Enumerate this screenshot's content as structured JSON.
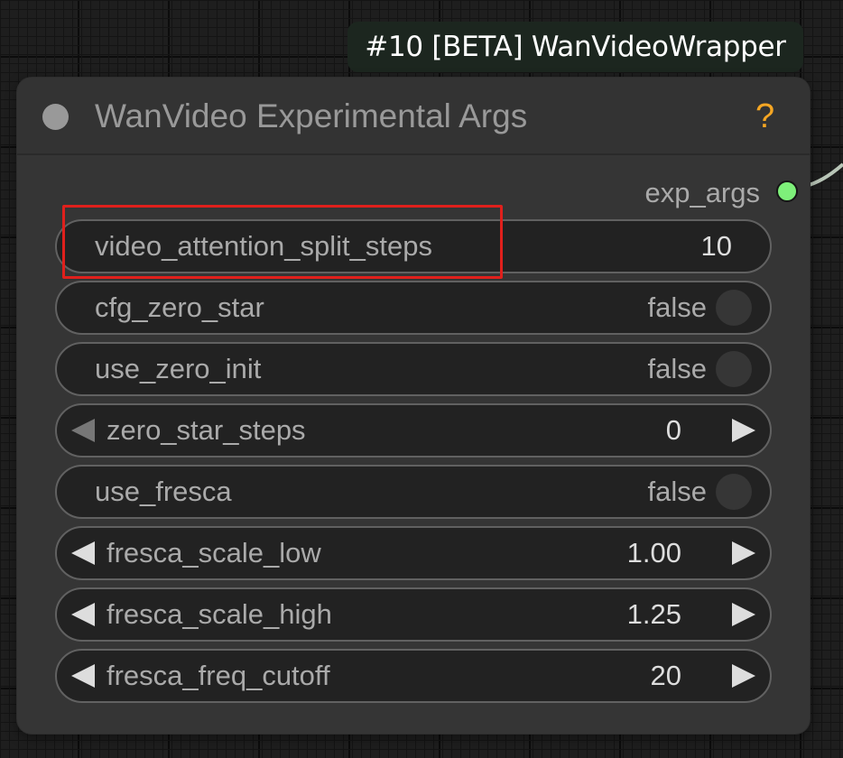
{
  "badge": {
    "text": "#10 [BETA] WanVideoWrapper"
  },
  "node": {
    "title": "WanVideo Experimental Args",
    "help_icon": "?",
    "output": {
      "label": "exp_args",
      "color": "#7ef07a"
    }
  },
  "widgets": [
    {
      "name": "video_attention_split_steps",
      "value": "10",
      "kind": "text",
      "highlighted": true
    },
    {
      "name": "cfg_zero_star",
      "value": "false",
      "kind": "toggle"
    },
    {
      "name": "use_zero_init",
      "value": "false",
      "kind": "toggle"
    },
    {
      "name": "zero_star_steps",
      "value": "0",
      "kind": "number"
    },
    {
      "name": "use_fresca",
      "value": "false",
      "kind": "toggle"
    },
    {
      "name": "fresca_scale_low",
      "value": "1.00",
      "kind": "number"
    },
    {
      "name": "fresca_scale_high",
      "value": "1.25",
      "kind": "number"
    },
    {
      "name": "fresca_freq_cutoff",
      "value": "20",
      "kind": "number"
    }
  ],
  "highlight_color": "#e0201c",
  "icons": [
    "collapse-dot-icon",
    "help-icon",
    "output-socket-icon",
    "decrement-arrow-icon",
    "increment-arrow-icon",
    "toggle-knob-icon"
  ]
}
